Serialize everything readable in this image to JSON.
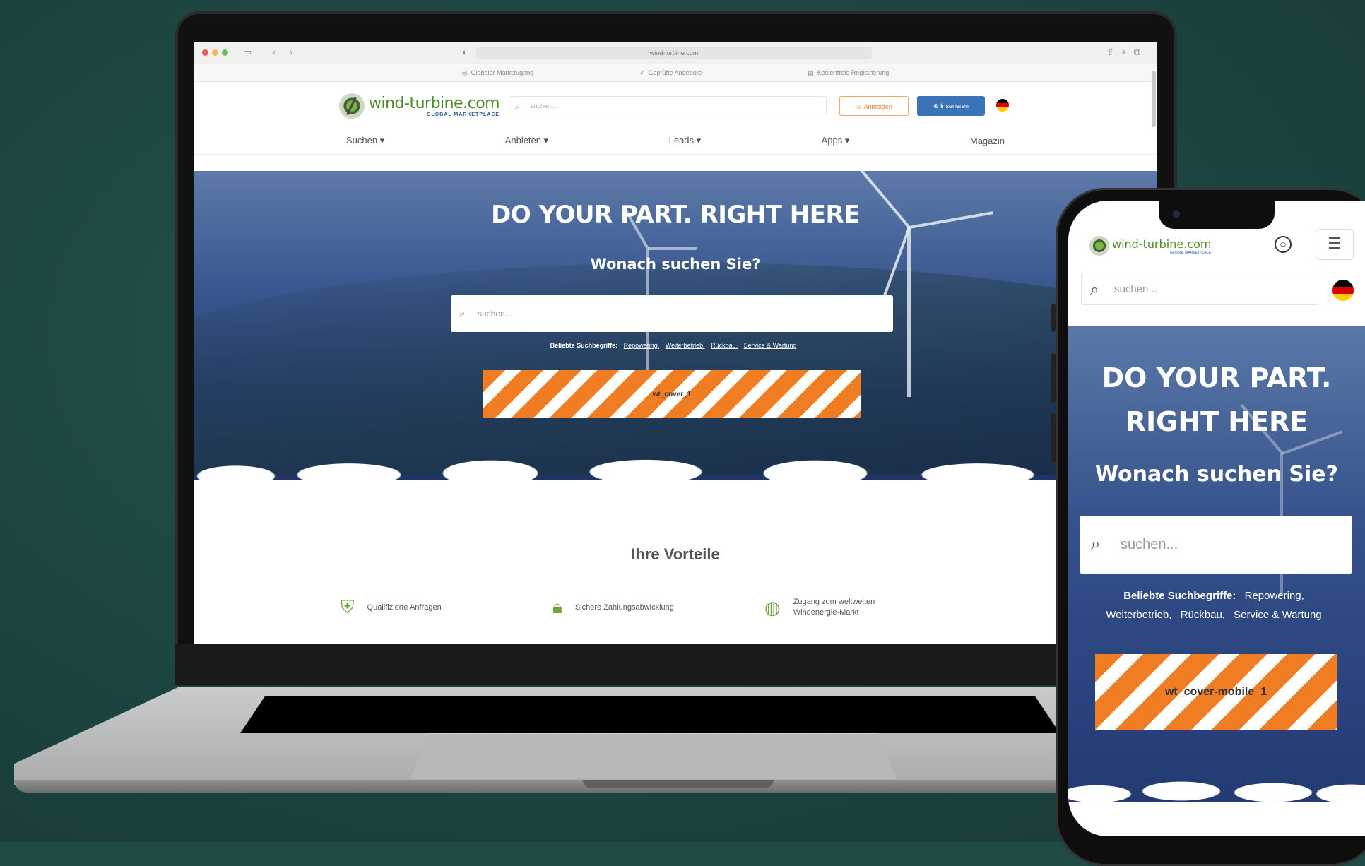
{
  "browser": {
    "address": "wind-turbine.com",
    "traffic_lights": [
      "#f25c54",
      "#f6be4f",
      "#61c554"
    ]
  },
  "infobar": {
    "items": [
      {
        "icon": "globe-icon",
        "label": "Globaler Marktzugang"
      },
      {
        "icon": "check-icon",
        "label": "Geprüfte Angebote"
      },
      {
        "icon": "document-icon",
        "label": "Kostenfreie Registrierung"
      }
    ]
  },
  "header": {
    "logo_name": "wind-turbine.com",
    "logo_sub": "GLOBAL MARKETPLACE",
    "search_placeholder": "suchen...",
    "login_label": "Anmelden",
    "post_label": "Inserieren"
  },
  "nav": {
    "items": [
      "Suchen ▾",
      "Anbieten ▾",
      "Leads ▾",
      "Apps ▾",
      "Magazin"
    ]
  },
  "hero": {
    "headline": "DO YOUR PART. RIGHT HERE",
    "question": "Wonach suchen Sie?",
    "search_placeholder": "suchen...",
    "popular_label": "Beliebte Suchbegriffe:",
    "popular_terms": [
      "Repowering,",
      "Weiterbetrieb,",
      "Rückbau,",
      "Service & Wartung"
    ],
    "banner": "wt_cover_1"
  },
  "benefits": {
    "title": "Ihre Vorteile",
    "items": [
      {
        "icon": "shield-icon",
        "label": "Qualifizierte Anfragen"
      },
      {
        "icon": "lock-icon",
        "label": "Sichere Zahlungsabwicklung"
      },
      {
        "icon": "globe-icon",
        "label": "Zugang zum weltweiten Windenergie-Markt"
      }
    ]
  },
  "mobile": {
    "logo_name": "wind-turbine.com",
    "logo_sub": "GLOBAL MARKETPLACE",
    "search_placeholder": "suchen...",
    "headline_line1": "DO YOUR PART.",
    "headline_line2": "RIGHT HERE",
    "question": "Wonach suchen Sie?",
    "big_search_placeholder": "suchen...",
    "popular_label": "Beliebte Suchbegriffe:",
    "popular_terms": [
      "Repowering,",
      "Weiterbetrieb,",
      "Rückbau,",
      "Service & Wartung"
    ],
    "banner": "wt_cover-mobile_1"
  },
  "colors": {
    "background": "#1f4a46",
    "brand_green": "#4a8c2a",
    "brand_blue": "#3a73b8",
    "accent_orange": "#f07d22"
  }
}
